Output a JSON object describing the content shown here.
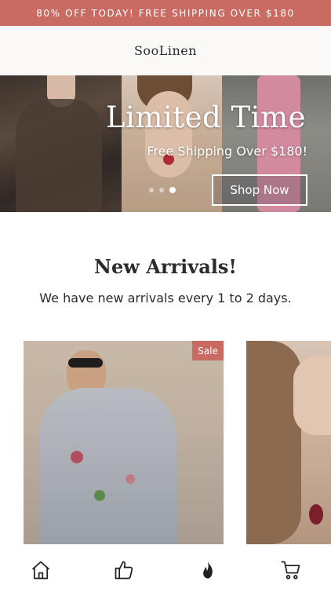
{
  "promo_bar": {
    "text": "80% OFF TODAY! FREE SHIPPING OVER $180",
    "color": "#c96b63"
  },
  "header": {
    "brand": "SooLinen"
  },
  "hero": {
    "title": "Limited Time",
    "subtitle": "Free Shipping Over $180!",
    "button_label": "Shop Now",
    "slide_count": 3,
    "active_slide": 3
  },
  "new_arrivals": {
    "title": "New Arrivals!",
    "subtitle": "We have new arrivals every 1 to 2 days."
  },
  "products": [
    {
      "badge": "Sale",
      "badge_color": "#c96b63"
    },
    {
      "badge": ""
    }
  ],
  "tab_bar": {
    "tabs": [
      {
        "icon": "home-icon"
      },
      {
        "icon": "thumbs-up-icon"
      },
      {
        "icon": "flame-icon"
      },
      {
        "icon": "cart-icon"
      }
    ]
  }
}
